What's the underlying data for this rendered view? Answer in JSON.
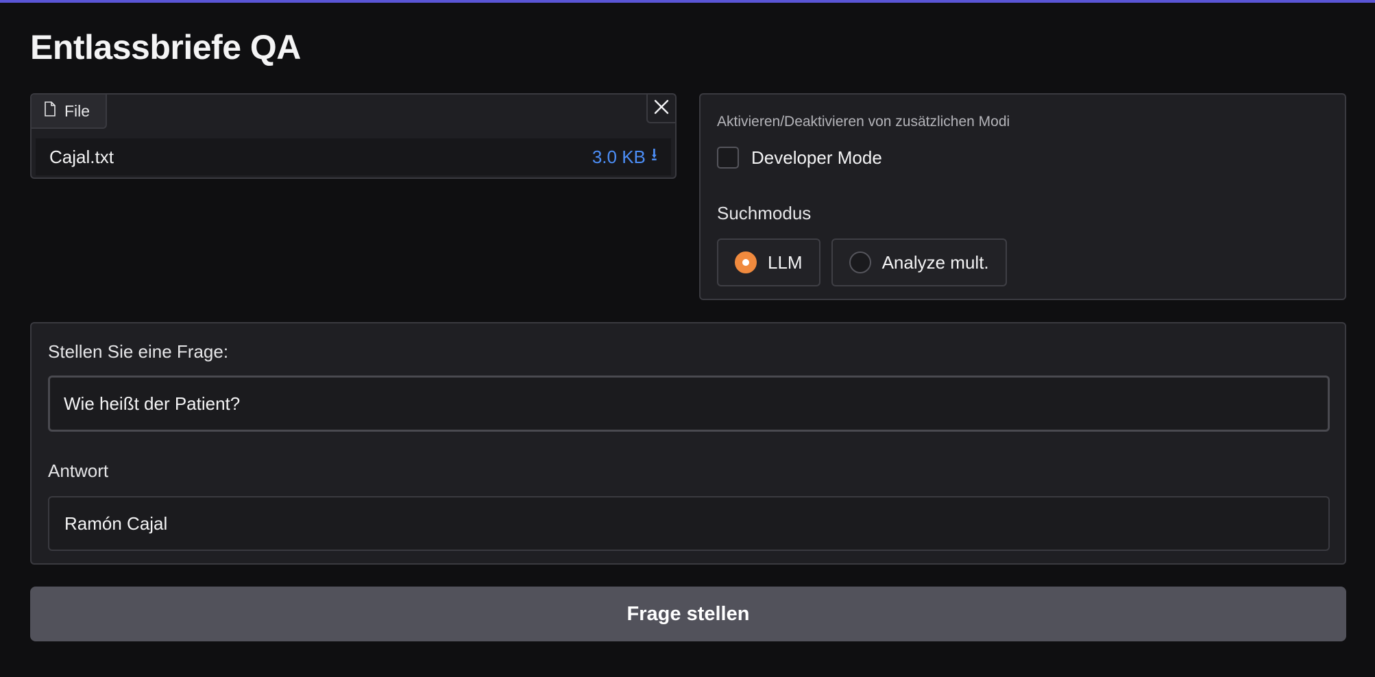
{
  "app": {
    "title": "Entlassbriefe QA",
    "accent_color": "#5a55d6"
  },
  "file_upload": {
    "tab_label": "File",
    "tab_icon": "file-icon",
    "close_icon": "close-icon",
    "file": {
      "name": "Cajal.txt",
      "size": "3.0 KB",
      "download_glyph": "⭳",
      "link_color": "#4c8ef7"
    }
  },
  "modes": {
    "caption": "Aktivieren/Deaktivieren von zusätzlichen Modi",
    "developer_mode": {
      "label": "Developer Mode",
      "checked": false
    },
    "search_mode": {
      "label": "Suchmodus",
      "options": [
        {
          "label": "LLM",
          "selected": true
        },
        {
          "label": "Analyze mult.",
          "selected": false
        }
      ],
      "selected_color": "#f08a3e"
    }
  },
  "qa": {
    "question_label": "Stellen Sie eine Frage:",
    "question_value": "Wie heißt der Patient?",
    "answer_label": "Antwort",
    "answer_value": "Ramón Cajal"
  },
  "actions": {
    "submit_label": "Frage stellen"
  }
}
